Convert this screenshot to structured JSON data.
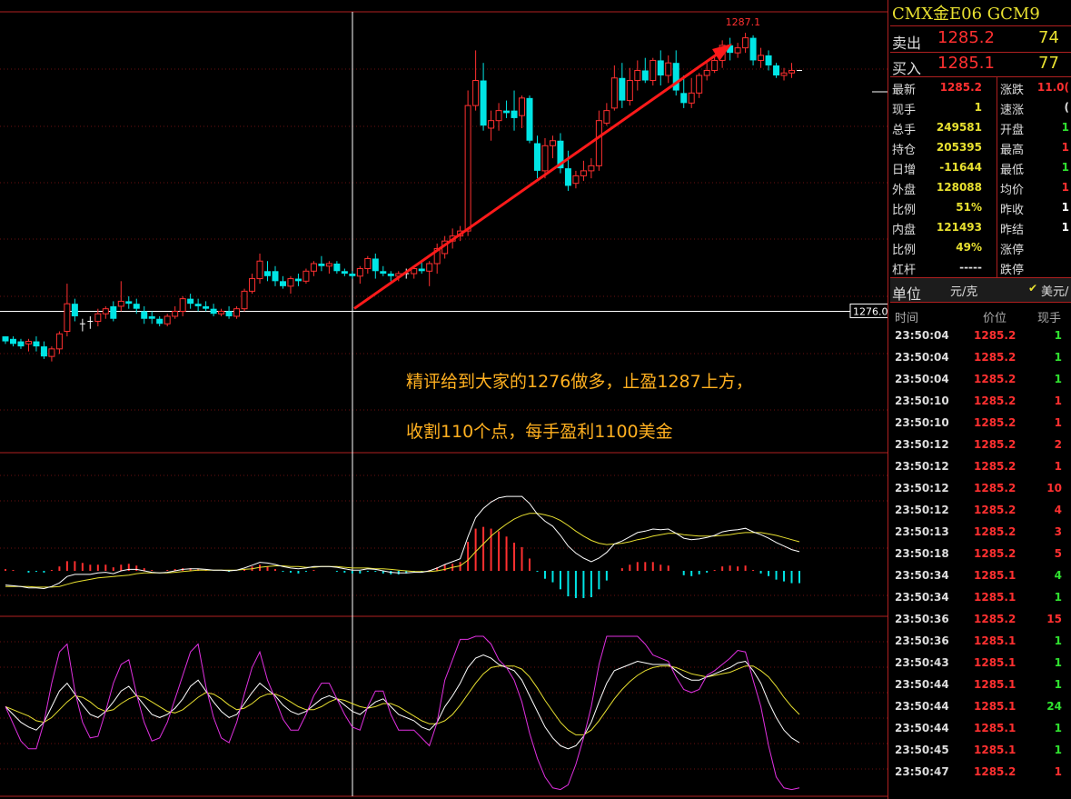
{
  "quote": {
    "title": "CMX金E06  GCM9",
    "sell_label": "卖出",
    "sell_price": "1285.2",
    "sell_vol": "74",
    "buy_label": "买入",
    "buy_price": "1285.1",
    "buy_vol": "77"
  },
  "stats_left": [
    {
      "label": "最新",
      "value": "1285.2",
      "color": "#ff3030"
    },
    {
      "label": "现手",
      "value": "1",
      "color": "#e8e030"
    },
    {
      "label": "总手",
      "value": "249581",
      "color": "#e8e030"
    },
    {
      "label": "持仓",
      "value": "205395",
      "color": "#e8e030"
    },
    {
      "label": "日增",
      "value": "-11644",
      "color": "#e8e030"
    },
    {
      "label": "外盘",
      "value": "128088",
      "color": "#e8e030"
    },
    {
      "label": "比例",
      "value": "51%",
      "color": "#e8e030"
    },
    {
      "label": "内盘",
      "value": "121493",
      "color": "#e8e030"
    },
    {
      "label": "比例",
      "value": "49%",
      "color": "#e8e030"
    },
    {
      "label": "杠杆",
      "value": "-----",
      "color": "#dddddd"
    }
  ],
  "stats_right": [
    {
      "label": "涨跌",
      "value": "11.0(",
      "color": "#ff3030"
    },
    {
      "label": "速涨",
      "value": "(",
      "color": "#dddddd"
    },
    {
      "label": "开盘",
      "value": "1",
      "color": "#30e030"
    },
    {
      "label": "最高",
      "value": "1",
      "color": "#ff3030"
    },
    {
      "label": "最低",
      "value": "1",
      "color": "#30e030"
    },
    {
      "label": "均价",
      "value": "1",
      "color": "#ff3030"
    },
    {
      "label": "昨收",
      "value": "1",
      "color": "#ffffff"
    },
    {
      "label": "昨结",
      "value": "1",
      "color": "#ffffff"
    },
    {
      "label": "涨停",
      "value": "",
      "color": "#dddddd"
    },
    {
      "label": "跌停",
      "value": "",
      "color": "#dddddd"
    }
  ],
  "unit": {
    "label": "单位",
    "value": "元/克",
    "check": "✔",
    "currency": "美元/"
  },
  "trades_header": {
    "time": "时间",
    "price": "价位",
    "volume": "现手"
  },
  "trades": [
    {
      "time": "23:50:04",
      "price": "1285.2",
      "vol": "1",
      "vcolor": "#30e030"
    },
    {
      "time": "23:50:04",
      "price": "1285.2",
      "vol": "1",
      "vcolor": "#30e030"
    },
    {
      "time": "23:50:04",
      "price": "1285.2",
      "vol": "1",
      "vcolor": "#30e030"
    },
    {
      "time": "23:50:10",
      "price": "1285.2",
      "vol": "1",
      "vcolor": "#ff3030"
    },
    {
      "time": "23:50:10",
      "price": "1285.2",
      "vol": "1",
      "vcolor": "#ff3030"
    },
    {
      "time": "23:50:12",
      "price": "1285.2",
      "vol": "2",
      "vcolor": "#ff3030"
    },
    {
      "time": "23:50:12",
      "price": "1285.2",
      "vol": "1",
      "vcolor": "#ff3030"
    },
    {
      "time": "23:50:12",
      "price": "1285.2",
      "vol": "10",
      "vcolor": "#ff3030"
    },
    {
      "time": "23:50:12",
      "price": "1285.2",
      "vol": "4",
      "vcolor": "#ff3030"
    },
    {
      "time": "23:50:13",
      "price": "1285.2",
      "vol": "3",
      "vcolor": "#ff3030"
    },
    {
      "time": "23:50:18",
      "price": "1285.2",
      "vol": "5",
      "vcolor": "#ff3030"
    },
    {
      "time": "23:50:34",
      "price": "1285.1",
      "vol": "4",
      "vcolor": "#30e030"
    },
    {
      "time": "23:50:34",
      "price": "1285.1",
      "vol": "1",
      "vcolor": "#30e030"
    },
    {
      "time": "23:50:36",
      "price": "1285.2",
      "vol": "15",
      "vcolor": "#ff3030"
    },
    {
      "time": "23:50:36",
      "price": "1285.1",
      "vol": "1",
      "vcolor": "#30e030"
    },
    {
      "time": "23:50:43",
      "price": "1285.1",
      "vol": "1",
      "vcolor": "#30e030"
    },
    {
      "time": "23:50:44",
      "price": "1285.1",
      "vol": "1",
      "vcolor": "#30e030"
    },
    {
      "time": "23:50:44",
      "price": "1285.1",
      "vol": "24",
      "vcolor": "#30e030"
    },
    {
      "time": "23:50:44",
      "price": "1285.1",
      "vol": "1",
      "vcolor": "#30e030"
    },
    {
      "time": "23:50:45",
      "price": "1285.1",
      "vol": "1",
      "vcolor": "#30e030"
    },
    {
      "time": "23:50:47",
      "price": "1285.2",
      "vol": "1",
      "vcolor": "#ff3030"
    }
  ],
  "annotation": {
    "line1": "精评给到大家的1276做多，止盈1287上方，",
    "line2": "收割110个点，每手盈利1100美金"
  },
  "chart_data": {
    "type": "candlestick",
    "ylim": [
      1270.4,
      1287.9
    ],
    "price_marker": "1276.0",
    "high_label": "1287.1",
    "colors": {
      "up": "#ff3030",
      "down": "#00e5e5",
      "arrow": "#ff1a1a",
      "macd_fast": "#ffffff",
      "macd_slow": "#e8e030",
      "kdj_j": "#e030e0"
    },
    "candles": [
      [
        1275.0,
        1275.0,
        1274.7,
        1274.8
      ],
      [
        1274.9,
        1275.0,
        1274.6,
        1274.7
      ],
      [
        1274.8,
        1274.9,
        1274.5,
        1274.6
      ],
      [
        1274.7,
        1274.9,
        1274.4,
        1274.8
      ],
      [
        1274.8,
        1275.0,
        1274.4,
        1274.6
      ],
      [
        1274.6,
        1274.8,
        1274.1,
        1274.2
      ],
      [
        1274.2,
        1274.6,
        1274.0,
        1274.5
      ],
      [
        1274.5,
        1275.2,
        1274.3,
        1275.1
      ],
      [
        1275.2,
        1277.1,
        1275.0,
        1276.3
      ],
      [
        1276.3,
        1276.5,
        1275.6,
        1275.8
      ],
      [
        1275.5,
        1275.7,
        1275.2,
        1275.5
      ],
      [
        1275.6,
        1275.8,
        1275.3,
        1275.6
      ],
      [
        1275.6,
        1276.1,
        1275.4,
        1275.9
      ],
      [
        1275.9,
        1276.2,
        1275.7,
        1276.1
      ],
      [
        1276.2,
        1276.4,
        1275.6,
        1275.7
      ],
      [
        1276.2,
        1277.2,
        1276.0,
        1276.4
      ],
      [
        1276.4,
        1276.6,
        1276.1,
        1276.3
      ],
      [
        1276.3,
        1276.5,
        1275.9,
        1276.1
      ],
      [
        1276.0,
        1276.2,
        1275.5,
        1275.7
      ],
      [
        1275.8,
        1276.0,
        1275.5,
        1275.7
      ],
      [
        1275.7,
        1275.8,
        1275.4,
        1275.5
      ],
      [
        1275.5,
        1275.9,
        1275.4,
        1275.8
      ],
      [
        1275.8,
        1276.2,
        1275.7,
        1276.0
      ],
      [
        1276.0,
        1276.6,
        1275.8,
        1276.5
      ],
      [
        1276.5,
        1276.7,
        1276.1,
        1276.3
      ],
      [
        1276.3,
        1276.5,
        1276.0,
        1276.2
      ],
      [
        1276.2,
        1276.4,
        1276.0,
        1276.1
      ],
      [
        1276.1,
        1276.3,
        1275.8,
        1275.9
      ],
      [
        1275.9,
        1276.1,
        1275.8,
        1276.0
      ],
      [
        1276.0,
        1276.2,
        1275.7,
        1275.8
      ],
      [
        1275.8,
        1276.2,
        1275.7,
        1276.1
      ],
      [
        1276.1,
        1276.9,
        1276.0,
        1276.8
      ],
      [
        1276.8,
        1277.5,
        1276.7,
        1277.3
      ],
      [
        1277.3,
        1278.3,
        1277.1,
        1278.0
      ],
      [
        1277.6,
        1278.0,
        1277.2,
        1277.4
      ],
      [
        1277.6,
        1277.8,
        1277.0,
        1277.2
      ],
      [
        1277.2,
        1277.4,
        1276.9,
        1277.0
      ],
      [
        1277.0,
        1277.4,
        1276.7,
        1277.3
      ],
      [
        1277.3,
        1277.5,
        1277.0,
        1277.2
      ],
      [
        1277.2,
        1277.7,
        1277.1,
        1277.6
      ],
      [
        1277.6,
        1278.0,
        1277.4,
        1277.9
      ],
      [
        1277.9,
        1278.2,
        1277.6,
        1277.8
      ],
      [
        1277.8,
        1278.0,
        1277.5,
        1277.9
      ],
      [
        1277.9,
        1278.0,
        1277.5,
        1277.6
      ],
      [
        1277.6,
        1277.7,
        1277.4,
        1277.5
      ],
      [
        1277.5,
        1277.6,
        1277.3,
        1277.4
      ],
      [
        1277.4,
        1277.8,
        1277.1,
        1277.7
      ],
      [
        1277.7,
        1278.2,
        1277.5,
        1278.1
      ],
      [
        1278.1,
        1278.3,
        1277.3,
        1277.6
      ],
      [
        1277.6,
        1277.8,
        1277.4,
        1277.5
      ],
      [
        1277.5,
        1277.6,
        1277.2,
        1277.4
      ],
      [
        1277.4,
        1277.6,
        1277.2,
        1277.5
      ],
      [
        1277.5,
        1277.7,
        1277.3,
        1277.5
      ],
      [
        1277.5,
        1277.8,
        1277.3,
        1277.7
      ],
      [
        1277.7,
        1278.0,
        1277.5,
        1277.6
      ],
      [
        1277.6,
        1278.0,
        1277.0,
        1277.9
      ],
      [
        1277.9,
        1278.7,
        1277.5,
        1278.5
      ],
      [
        1278.3,
        1279.0,
        1278.1,
        1278.8
      ],
      [
        1278.8,
        1279.3,
        1278.5,
        1279.0
      ],
      [
        1279.0,
        1279.4,
        1278.8,
        1279.2
      ],
      [
        1279.2,
        1284.8,
        1279.0,
        1284.2
      ],
      [
        1284.2,
        1286.4,
        1284.0,
        1285.2
      ],
      [
        1285.2,
        1285.9,
        1283.2,
        1283.4
      ],
      [
        1283.3,
        1284.0,
        1282.8,
        1283.6
      ],
      [
        1283.6,
        1284.3,
        1283.2,
        1284.0
      ],
      [
        1284.0,
        1284.4,
        1283.7,
        1283.9
      ],
      [
        1284.0,
        1284.8,
        1283.2,
        1283.7
      ],
      [
        1283.8,
        1284.6,
        1283.3,
        1284.5
      ],
      [
        1284.5,
        1284.6,
        1282.7,
        1282.8
      ],
      [
        1282.7,
        1283.0,
        1281.3,
        1281.6
      ],
      [
        1281.6,
        1282.9,
        1281.3,
        1282.6
      ],
      [
        1282.6,
        1283.0,
        1282.1,
        1282.8
      ],
      [
        1282.8,
        1283.1,
        1281.5,
        1281.7
      ],
      [
        1281.7,
        1282.4,
        1280.8,
        1281.0
      ],
      [
        1281.1,
        1281.6,
        1280.9,
        1281.4
      ],
      [
        1281.4,
        1282.0,
        1281.2,
        1281.6
      ],
      [
        1281.6,
        1282.1,
        1281.3,
        1281.8
      ],
      [
        1281.8,
        1284.0,
        1281.6,
        1283.6
      ],
      [
        1283.5,
        1284.3,
        1283.4,
        1284.0
      ],
      [
        1284.1,
        1285.8,
        1284.0,
        1285.3
      ],
      [
        1285.3,
        1285.9,
        1284.1,
        1284.4
      ],
      [
        1284.4,
        1285.7,
        1284.2,
        1285.2
      ],
      [
        1285.2,
        1286.0,
        1284.8,
        1285.6
      ],
      [
        1285.6,
        1286.1,
        1285.1,
        1285.2
      ],
      [
        1285.2,
        1286.1,
        1285.0,
        1286.0
      ],
      [
        1286.0,
        1286.4,
        1285.0,
        1285.4
      ],
      [
        1285.4,
        1286.2,
        1285.1,
        1285.9
      ],
      [
        1285.9,
        1286.4,
        1284.6,
        1284.8
      ],
      [
        1284.7,
        1285.4,
        1284.1,
        1284.3
      ],
      [
        1284.3,
        1285.3,
        1284.1,
        1284.7
      ],
      [
        1284.7,
        1285.5,
        1284.5,
        1285.4
      ],
      [
        1285.4,
        1285.9,
        1285.2,
        1285.6
      ],
      [
        1285.6,
        1286.2,
        1285.5,
        1286.0
      ],
      [
        1286.0,
        1286.8,
        1285.7,
        1286.6
      ],
      [
        1286.6,
        1286.9,
        1286.0,
        1286.3
      ],
      [
        1286.3,
        1286.7,
        1286.1,
        1286.5
      ],
      [
        1286.5,
        1287.1,
        1286.3,
        1286.9
      ],
      [
        1286.9,
        1287.0,
        1285.8,
        1286.0
      ],
      [
        1286.0,
        1286.5,
        1285.7,
        1286.2
      ],
      [
        1286.2,
        1286.4,
        1285.6,
        1285.8
      ],
      [
        1285.8,
        1285.9,
        1285.3,
        1285.4
      ],
      [
        1285.4,
        1285.7,
        1285.2,
        1285.5
      ],
      [
        1285.5,
        1285.9,
        1285.3,
        1285.6
      ],
      [
        1285.6,
        1285.6,
        1285.6,
        1285.6
      ]
    ],
    "macd_dif": [
      -0.2,
      -0.21,
      -0.22,
      -0.24,
      -0.24,
      -0.25,
      -0.22,
      -0.17,
      -0.08,
      -0.05,
      -0.05,
      -0.05,
      -0.03,
      -0.02,
      -0.04,
      0.0,
      0.02,
      0.02,
      0.0,
      -0.02,
      -0.03,
      -0.02,
      0.0,
      0.02,
      0.03,
      0.03,
      0.02,
      0.01,
      0.01,
      0.0,
      0.01,
      0.04,
      0.08,
      0.12,
      0.11,
      0.09,
      0.06,
      0.04,
      0.03,
      0.04,
      0.06,
      0.06,
      0.06,
      0.05,
      0.03,
      0.01,
      0.01,
      0.03,
      0.02,
      0.0,
      -0.02,
      -0.03,
      -0.03,
      -0.02,
      -0.02,
      0.0,
      0.04,
      0.09,
      0.13,
      0.17,
      0.48,
      0.75,
      0.88,
      0.97,
      1.03,
      1.05,
      1.05,
      1.05,
      0.95,
      0.8,
      0.7,
      0.63,
      0.5,
      0.35,
      0.25,
      0.18,
      0.13,
      0.18,
      0.26,
      0.38,
      0.42,
      0.48,
      0.54,
      0.56,
      0.59,
      0.58,
      0.59,
      0.53,
      0.46,
      0.44,
      0.45,
      0.47,
      0.5,
      0.55,
      0.57,
      0.58,
      0.6,
      0.55,
      0.51,
      0.46,
      0.4,
      0.35,
      0.3,
      0.27
    ],
    "macd_dea": [
      -0.22,
      -0.22,
      -0.22,
      -0.22,
      -0.23,
      -0.23,
      -0.23,
      -0.22,
      -0.19,
      -0.16,
      -0.14,
      -0.12,
      -0.1,
      -0.09,
      -0.08,
      -0.07,
      -0.06,
      -0.04,
      -0.03,
      -0.03,
      -0.03,
      -0.03,
      -0.02,
      -0.01,
      0.0,
      0.01,
      0.01,
      0.01,
      0.01,
      0.01,
      0.01,
      0.02,
      0.03,
      0.05,
      0.06,
      0.07,
      0.07,
      0.06,
      0.06,
      0.05,
      0.05,
      0.06,
      0.06,
      0.06,
      0.05,
      0.04,
      0.04,
      0.04,
      0.03,
      0.03,
      0.02,
      0.01,
      0.0,
      -0.01,
      -0.01,
      -0.01,
      0.0,
      0.02,
      0.05,
      0.07,
      0.15,
      0.27,
      0.38,
      0.49,
      0.58,
      0.66,
      0.73,
      0.78,
      0.81,
      0.81,
      0.79,
      0.76,
      0.71,
      0.64,
      0.56,
      0.49,
      0.43,
      0.39,
      0.37,
      0.38,
      0.39,
      0.41,
      0.44,
      0.46,
      0.49,
      0.51,
      0.53,
      0.53,
      0.51,
      0.5,
      0.49,
      0.49,
      0.49,
      0.5,
      0.51,
      0.53,
      0.54,
      0.54,
      0.54,
      0.52,
      0.5,
      0.47,
      0.44,
      0.41
    ],
    "kdj_k": [
      55,
      50,
      45,
      42,
      40,
      45,
      55,
      65,
      70,
      63,
      56,
      50,
      48,
      52,
      58,
      65,
      68,
      62,
      56,
      50,
      48,
      50,
      54,
      60,
      68,
      72,
      65,
      58,
      52,
      48,
      50,
      57,
      64,
      70,
      66,
      62,
      56,
      52,
      50,
      52,
      56,
      60,
      62,
      60,
      56,
      52,
      50,
      54,
      58,
      60,
      55,
      50,
      48,
      46,
      42,
      40,
      45,
      55,
      62,
      70,
      80,
      86,
      88,
      86,
      82,
      80,
      78,
      72,
      62,
      52,
      42,
      35,
      30,
      28,
      30,
      36,
      45,
      58,
      70,
      78,
      80,
      82,
      84,
      83,
      82,
      82,
      82,
      78,
      74,
      72,
      72,
      74,
      76,
      78,
      80,
      83,
      84,
      78,
      70,
      58,
      48,
      40,
      35,
      32
    ],
    "kdj_d": [
      55,
      53,
      51,
      49,
      46,
      45,
      48,
      53,
      58,
      62,
      61,
      58,
      54,
      52,
      53,
      57,
      60,
      62,
      61,
      58,
      55,
      52,
      51,
      53,
      57,
      61,
      64,
      63,
      60,
      56,
      53,
      54,
      57,
      61,
      63,
      63,
      61,
      58,
      55,
      53,
      53,
      55,
      58,
      60,
      59,
      57,
      55,
      54,
      55,
      57,
      57,
      55,
      52,
      49,
      46,
      44,
      44,
      46,
      50,
      56,
      63,
      70,
      76,
      80,
      81,
      81,
      81,
      79,
      74,
      67,
      59,
      52,
      45,
      40,
      37,
      37,
      40,
      46,
      53,
      60,
      66,
      71,
      75,
      78,
      80,
      81,
      81,
      80,
      78,
      76,
      75,
      74,
      75,
      76,
      77,
      79,
      81,
      81,
      78,
      74,
      68,
      61,
      55,
      50
    ],
    "kdj_j": [
      55,
      44,
      33,
      28,
      28,
      45,
      70,
      90,
      95,
      65,
      45,
      35,
      36,
      52,
      70,
      82,
      85,
      63,
      45,
      33,
      35,
      45,
      60,
      75,
      90,
      95,
      68,
      48,
      35,
      32,
      45,
      63,
      80,
      90,
      72,
      60,
      47,
      40,
      40,
      50,
      62,
      70,
      70,
      60,
      50,
      42,
      40,
      55,
      65,
      65,
      50,
      40,
      40,
      40,
      35,
      30,
      45,
      72,
      85,
      98,
      98,
      100,
      100,
      95,
      85,
      80,
      72,
      58,
      38,
      22,
      10,
      3,
      2,
      5,
      18,
      35,
      55,
      82,
      100,
      100,
      100,
      100,
      100,
      95,
      88,
      86,
      84,
      74,
      66,
      64,
      66,
      75,
      78,
      82,
      86,
      91,
      90,
      72,
      55,
      30,
      10,
      3,
      2,
      3
    ]
  }
}
